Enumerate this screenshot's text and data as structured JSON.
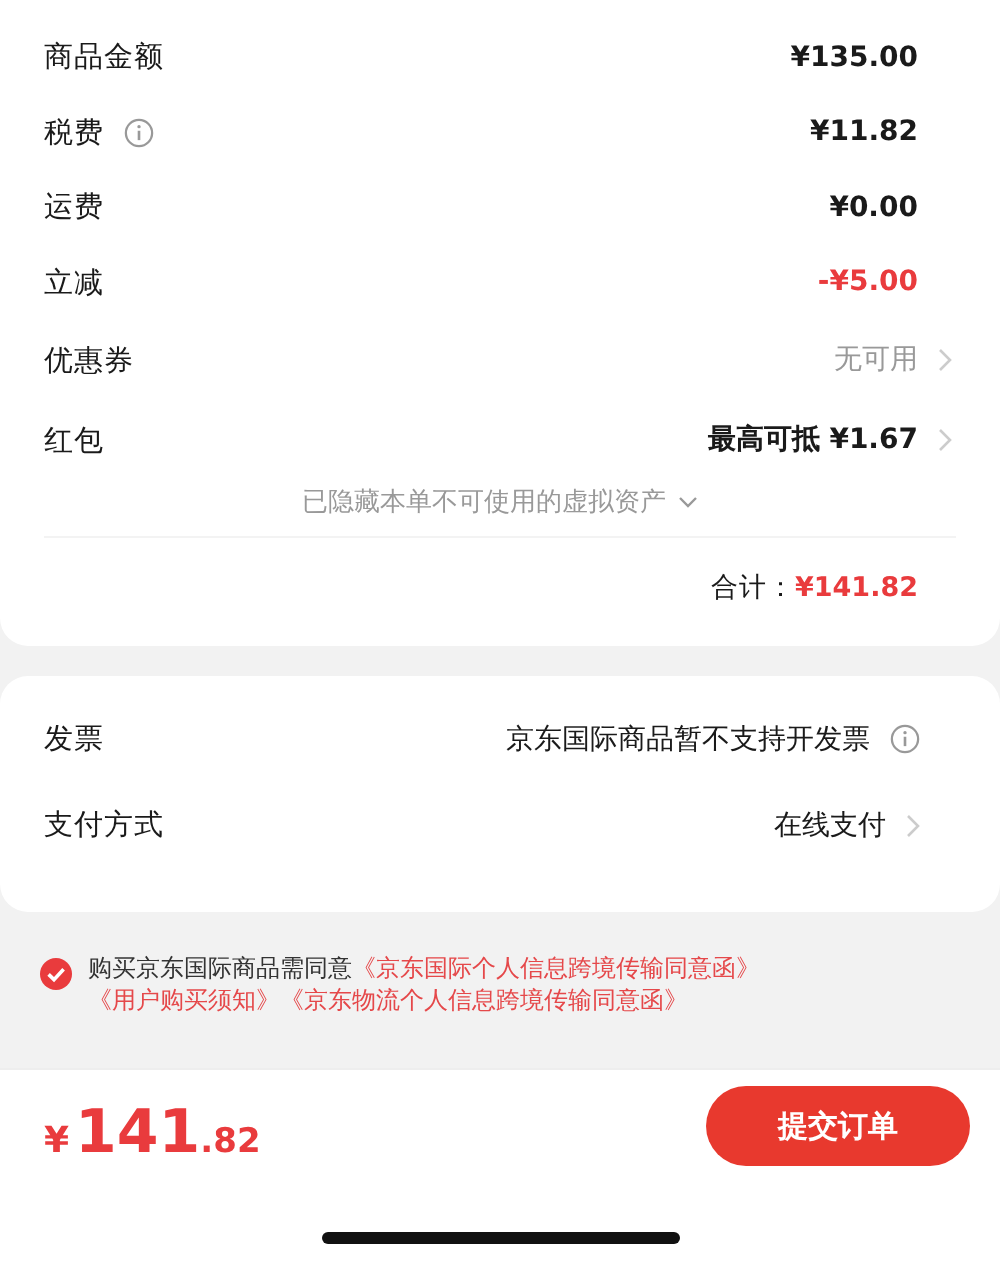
{
  "summary": {
    "rows": [
      {
        "label": "商品金额",
        "info": false,
        "value": "¥135.00",
        "kind": "amount",
        "chevron": false
      },
      {
        "label": "税费",
        "info": true,
        "value": "¥11.82",
        "kind": "amount",
        "chevron": false
      },
      {
        "label": "运费",
        "info": false,
        "value": "¥0.00",
        "kind": "amount",
        "chevron": false
      },
      {
        "label": "立减",
        "info": false,
        "value": "-¥5.00",
        "kind": "discount",
        "chevron": false
      },
      {
        "label": "优惠券",
        "info": false,
        "value": "无可用",
        "kind": "unavailable",
        "chevron": true
      },
      {
        "label": "红包",
        "info": false,
        "value": "最高可抵 ¥1.67",
        "kind": "amount",
        "chevron": true
      }
    ],
    "hidden_note": "已隐藏本单不可使用的虚拟资产",
    "hidden_expanded": false,
    "total_label": "合计：",
    "total_value": "¥141.82"
  },
  "options": {
    "rows": [
      {
        "label": "发票",
        "value": "京东国际商品暂不支持开发票",
        "info": true,
        "chevron": false
      },
      {
        "label": "支付方式",
        "value": "在线支付",
        "info": false,
        "chevron": true
      }
    ]
  },
  "agreement": {
    "checked": true,
    "text": "购买京东国际商品需同意",
    "links": [
      "《京东国际个人信息跨境传输同意函》",
      "《用户购买须知》",
      "《京东物流个人信息跨境传输同意函》"
    ]
  },
  "footer": {
    "currency": "¥",
    "integer": "141",
    "decimal": ".82",
    "button": "提交订单"
  }
}
